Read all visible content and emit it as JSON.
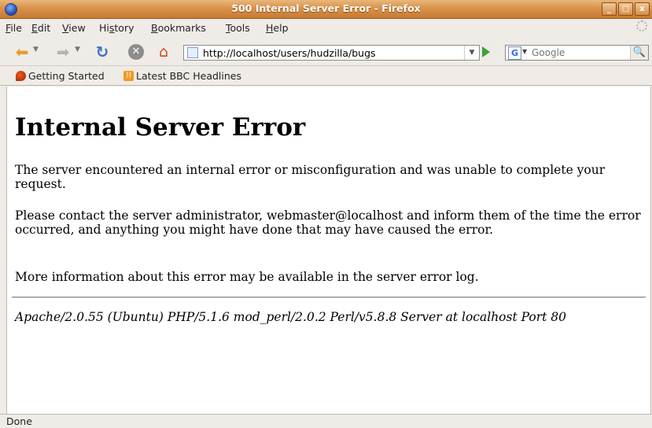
{
  "window": {
    "title": "500 Internal Server Error - Firefox",
    "buttons": {
      "minimize": "_",
      "maximize": "□",
      "close": "x"
    }
  },
  "menu": [
    {
      "underline": "F",
      "rest": "ile"
    },
    {
      "underline": "E",
      "rest": "dit"
    },
    {
      "underline": "V",
      "rest": "iew"
    },
    {
      "pre": "Hi",
      "underline": "s",
      "rest": "tory"
    },
    {
      "underline": "B",
      "rest": "ookmarks"
    },
    {
      "underline": "T",
      "rest": "ools"
    },
    {
      "underline": "H",
      "rest": "elp"
    }
  ],
  "toolbar": {
    "url": "http://localhost/users/hudzilla/bugs",
    "search_placeholder": "Google",
    "search_engine_letter": "G"
  },
  "bookmarks": [
    {
      "label": "Getting Started",
      "icon": "firefox-icon"
    },
    {
      "label": "Latest BBC Headlines",
      "icon": "rss-icon"
    }
  ],
  "page": {
    "heading": "Internal Server Error",
    "paragraph1": "The server encountered an internal error or misconfiguration and was unable to complete your request.",
    "paragraph2": "Please contact the server administrator, webmaster@localhost and inform them of the time the error occurred, and anything you might have done that may have caused the error.",
    "paragraph3": "More information about this error may be available in the server error log.",
    "address": "Apache/2.0.55 (Ubuntu) PHP/5.1.6 mod_perl/2.0.2 Perl/v5.8.8 Server at localhost Port 80"
  },
  "status": {
    "text": "Done"
  },
  "colors": {
    "titlebar": "#d8924a",
    "chrome": "#efebe7",
    "go": "#37a33b"
  }
}
